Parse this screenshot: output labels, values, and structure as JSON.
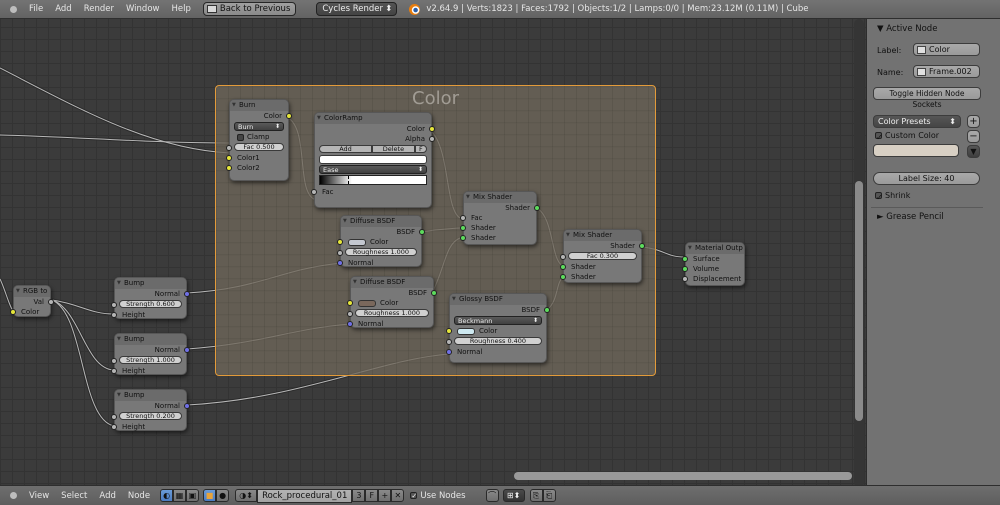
{
  "topbar": {
    "menus": [
      "File",
      "Add",
      "Render",
      "Window",
      "Help"
    ],
    "back_button": "Back to Previous",
    "render_engine": "Cycles Render",
    "stats": "v2.64.9 | Verts:1823 | Faces:1792 | Objects:1/2 | Lamps:0/0 | Mem:23.12M (0.11M) | Cube"
  },
  "frame": {
    "label": "Color",
    "border_color": "#e39b3a"
  },
  "nodes": {
    "burn": {
      "title": "Burn",
      "out": "Color",
      "blend_mode": "Burn",
      "clamp": "Clamp",
      "fac": "Fac 0.500",
      "in1": "Color1",
      "in2": "Color2"
    },
    "colorramp": {
      "title": "ColorRamp",
      "out1": "Color",
      "out2": "Alpha",
      "add": "Add",
      "delete": "Delete",
      "flip": "F",
      "interp": "Ease",
      "in": "Fac"
    },
    "diffuse1": {
      "title": "Diffuse BSDF",
      "out": "BSDF",
      "color": "Color",
      "color_value": "#c4c8d0",
      "roughness": "Roughness 1.000",
      "normal": "Normal"
    },
    "diffuse2": {
      "title": "Diffuse BSDF",
      "out": "BSDF",
      "color": "Color",
      "color_value": "#7a685c",
      "roughness": "Roughness 1.000",
      "normal": "Normal"
    },
    "mix1": {
      "title": "Mix Shader",
      "out": "Shader",
      "fac": "Fac",
      "sh1": "Shader",
      "sh2": "Shader"
    },
    "mix2": {
      "title": "Mix Shader",
      "out": "Shader",
      "fac": "Fac 0.300",
      "sh1": "Shader",
      "sh2": "Shader"
    },
    "glossy": {
      "title": "Glossy BSDF",
      "out": "BSDF",
      "distribution": "Beckmann",
      "color": "Color",
      "color_value": "#cde8f0",
      "roughness": "Roughness 0.400",
      "normal": "Normal"
    },
    "output": {
      "title": "Material Outp",
      "surface": "Surface",
      "volume": "Volume",
      "displacement": "Displacement"
    },
    "rgbto": {
      "title": "RGB to",
      "out": "Val",
      "in": "Color"
    },
    "bump1": {
      "title": "Bump",
      "out": "Normal",
      "strength": "Strength 0.600",
      "in": "Height"
    },
    "bump2": {
      "title": "Bump",
      "out": "Normal",
      "strength": "Strength 1.000",
      "in": "Height"
    },
    "bump3": {
      "title": "Bump",
      "out": "Normal",
      "strength": "Strength 0.200",
      "in": "Height"
    }
  },
  "properties": {
    "active_node_title": "Active Node",
    "label_label": "Label:",
    "label_value": "Color",
    "name_label": "Name:",
    "name_value": "Frame.002",
    "toggle_sockets": "Toggle Hidden Node Sockets",
    "color_presets": "Color Presets",
    "custom_color": "Custom Color",
    "custom_color_value": "#d8d0c4",
    "label_size": "Label Size: 40",
    "shrink": "Shrink",
    "grease_pencil": "Grease Pencil"
  },
  "bottombar": {
    "menus": [
      "View",
      "Select",
      "Add",
      "Node"
    ],
    "material_name": "Rock_procedural_01",
    "users": "3",
    "fake_user": "F",
    "use_nodes": "Use Nodes"
  }
}
